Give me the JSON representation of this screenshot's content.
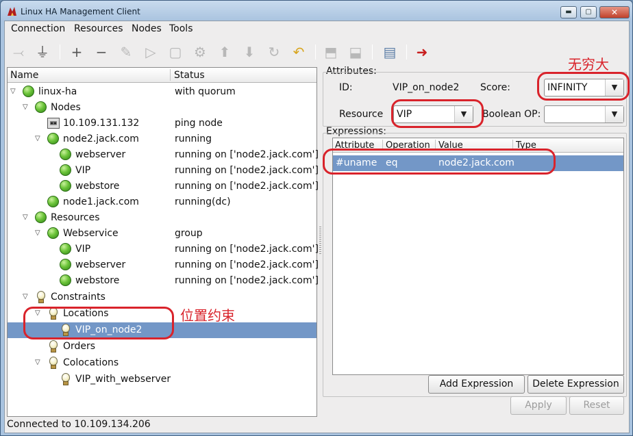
{
  "window": {
    "title": "Linux HA Management Client",
    "min_glyph": "▬",
    "max_glyph": "▢",
    "close_glyph": "✕"
  },
  "menu": [
    "Connection",
    "Resources",
    "Nodes",
    "Tools"
  ],
  "tree": {
    "columns": {
      "name": "Name",
      "status": "Status"
    },
    "rows": [
      {
        "label": "linux-ha",
        "status": "with quorum"
      },
      {
        "label": "Nodes",
        "status": ""
      },
      {
        "label": "10.109.131.132",
        "status": "ping node"
      },
      {
        "label": "node2.jack.com",
        "status": "running"
      },
      {
        "label": "webserver",
        "status": "running on ['node2.jack.com']"
      },
      {
        "label": "VIP",
        "status": "running on ['node2.jack.com']"
      },
      {
        "label": "webstore",
        "status": "running on ['node2.jack.com']"
      },
      {
        "label": "node1.jack.com",
        "status": "running(dc)"
      },
      {
        "label": "Resources",
        "status": ""
      },
      {
        "label": "Webservice",
        "status": "group"
      },
      {
        "label": "VIP",
        "status": "running on ['node2.jack.com']"
      },
      {
        "label": "webserver",
        "status": "running on ['node2.jack.com']"
      },
      {
        "label": "webstore",
        "status": "running on ['node2.jack.com']"
      },
      {
        "label": "Constraints",
        "status": ""
      },
      {
        "label": "Locations",
        "status": ""
      },
      {
        "label": "VIP_on_node2",
        "status": ""
      },
      {
        "label": "Orders",
        "status": ""
      },
      {
        "label": "Colocations",
        "status": ""
      },
      {
        "label": "VIP_with_webserver",
        "status": ""
      }
    ]
  },
  "attributes": {
    "group_label": "Attributes:",
    "id_label": "ID:",
    "id_value": "VIP_on_node2",
    "score_label": "Score:",
    "score_value": "INFINITY",
    "resource_label": "Resource",
    "resource_value": "VIP",
    "boolean_op_label": "Boolean OP:",
    "boolean_op_value": ""
  },
  "expressions": {
    "group_label": "Expressions:",
    "columns": [
      "Attribute",
      "Operation",
      "Value",
      "Type"
    ],
    "rows": [
      {
        "attribute": "#uname",
        "operation": "eq",
        "value": "node2.jack.com",
        "type": ""
      }
    ]
  },
  "buttons": {
    "add_expression": "Add Expression",
    "delete_expression": "Delete Expression",
    "apply": "Apply",
    "reset": "Reset"
  },
  "status_bar": "Connected to 10.109.134.206",
  "annotations": {
    "infinity_note": "无穷大",
    "location_note": "位置约束"
  },
  "colors": {
    "selection": "#7397c7",
    "annotation": "#d9232b"
  }
}
